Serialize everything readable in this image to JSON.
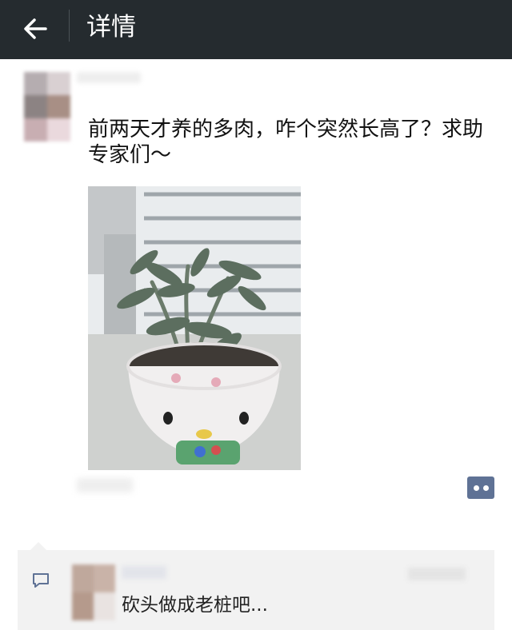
{
  "header": {
    "back_icon": "arrow-left-icon",
    "title": "详情"
  },
  "post": {
    "text": "前两天才养的多肉，咋个突然长高了？求助专家们～",
    "image_description_icon": "plant-photo",
    "more_icon": "more-dots-icon"
  },
  "comments": {
    "comment_icon": "comment-icon",
    "items": [
      {
        "text": "砍头做成老桩吧..."
      }
    ]
  },
  "colors": {
    "topbar": "#252b2f",
    "more_button": "#5f7295",
    "comment_bg": "#f2f2f2"
  }
}
